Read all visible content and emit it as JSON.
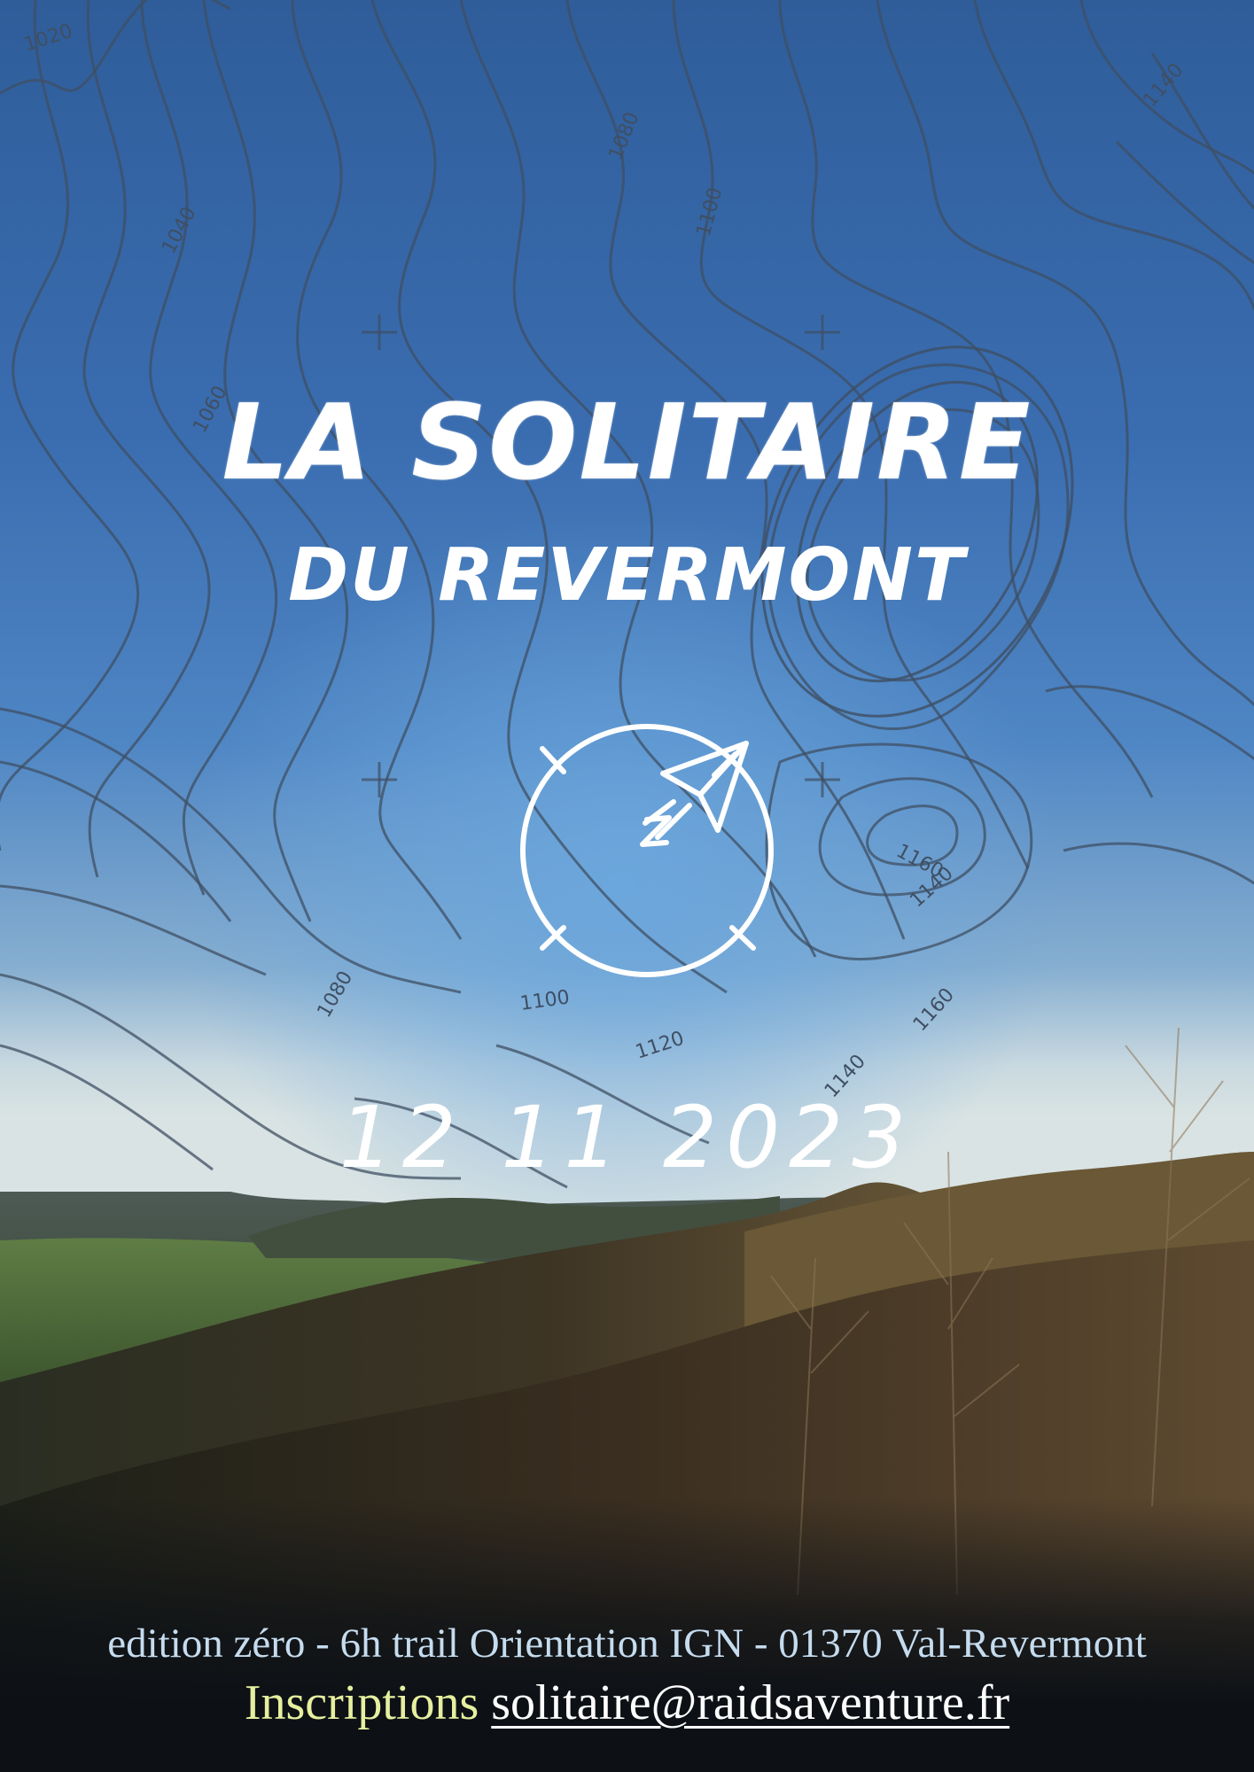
{
  "title": {
    "main": "LA SOLITAIRE",
    "sub": "DU REVERMONT"
  },
  "date": "12 11 2023",
  "info": "edition zéro - 6h trail Orientation IGN - 01370 Val-Revermont",
  "contact": {
    "label": "Inscriptions",
    "email": "solitaire@raidsaventure.fr"
  },
  "contour_labels": [
    "1020",
    "1040",
    "1060",
    "1080",
    "1100",
    "1080",
    "1100",
    "1120",
    "1140",
    "1160",
    "1140",
    "1160",
    "1140"
  ],
  "logo": {
    "icon": "compass-paper-plane-icon",
    "letter": "N"
  },
  "colors": {
    "sky_top": "#2f5d9a",
    "sky_glow": "#6ba6dc",
    "contour": "#3f4f63",
    "info_text": "#c5dcef",
    "contact_label": "#e6ef9f",
    "bottom_band": "#0d1116"
  }
}
